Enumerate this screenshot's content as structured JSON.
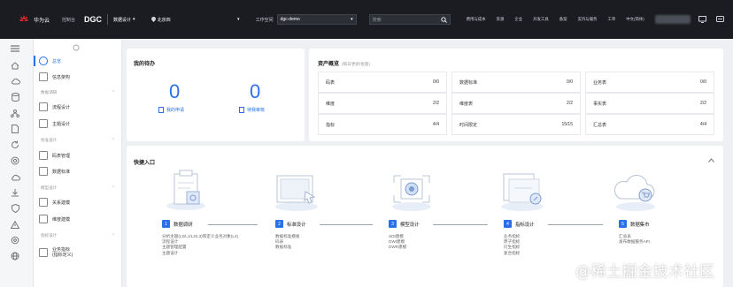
{
  "topbar": {
    "brand": "华为云",
    "console": "控制台",
    "product": "DGC",
    "module": "数据设计",
    "region": "北京四",
    "workspace_label": "工作空间",
    "workspace_value": "dgc-demo",
    "search_placeholder": "搜索",
    "links": [
      "费用与成本",
      "资源",
      "企业",
      "开发工具",
      "备案",
      "支持与服务",
      "工单",
      "中文(简体)"
    ]
  },
  "sidebar": {
    "items": [
      {
        "label": "总览"
      },
      {
        "label": "信息架构"
      }
    ],
    "groups": [
      {
        "label": "数据调研",
        "items": [
          {
            "label": "流程设计"
          },
          {
            "label": "主题设计"
          }
        ]
      },
      {
        "label": "标准设计",
        "items": [
          {
            "label": "码表管理"
          },
          {
            "label": "数据标准"
          }
        ]
      },
      {
        "label": "模型设计",
        "items": [
          {
            "label": "关系建模"
          },
          {
            "label": "维度建模"
          }
        ]
      },
      {
        "label": "指标设计",
        "items": [
          {
            "label": "业务指标",
            "sub": "(指标定义)"
          }
        ]
      }
    ]
  },
  "todo": {
    "title": "我的待办",
    "my_applications": {
      "count": "0",
      "label": "我的申请"
    },
    "pending_review": {
      "count": "0",
      "label": "待我审核"
    }
  },
  "assets": {
    "title": "资产概览",
    "subtitle": "(每日更新/批量)",
    "cells": [
      {
        "label": "码表",
        "value": "0/0"
      },
      {
        "label": "数据标准",
        "value": "0/0"
      },
      {
        "label": "业务表",
        "value": "0/0"
      },
      {
        "label": "维度",
        "value": "2/2"
      },
      {
        "label": "维度表",
        "value": "2/2"
      },
      {
        "label": "事实表",
        "value": "2/2"
      },
      {
        "label": "指标",
        "value": "4/4"
      },
      {
        "label": "时间限定",
        "value": "15/15"
      },
      {
        "label": "汇总表",
        "value": "4/4"
      }
    ]
  },
  "quick_entry": {
    "title": "快捷入口",
    "steps": [
      {
        "num": "1",
        "label": "数据调研",
        "subs": [
          "分析主题(L0/L1/L2/L3)和定义业务对象(L4)",
          "流程设计",
          "主题管理配置",
          "主题设计"
        ]
      },
      {
        "num": "2",
        "label": "标准设计",
        "subs": [
          "数据标准模板",
          "码表",
          "数据标准"
        ]
      },
      {
        "num": "3",
        "label": "模型设计",
        "subs": [
          "SDI建模",
          "DWI建模",
          "DWR建模"
        ]
      },
      {
        "num": "4",
        "label": "指标设计",
        "subs": [
          "业务指标",
          "原子指标",
          "衍生指标",
          "复合指标"
        ]
      },
      {
        "num": "5",
        "label": "数据集市",
        "subs": [
          "汇总表",
          "发布数据服务API"
        ]
      }
    ]
  },
  "watermark": "@稀土掘金技术社区",
  "colors": {
    "accent": "#2a70e8",
    "topbar": "#1a1c21",
    "brand_red": "#e0282e"
  }
}
